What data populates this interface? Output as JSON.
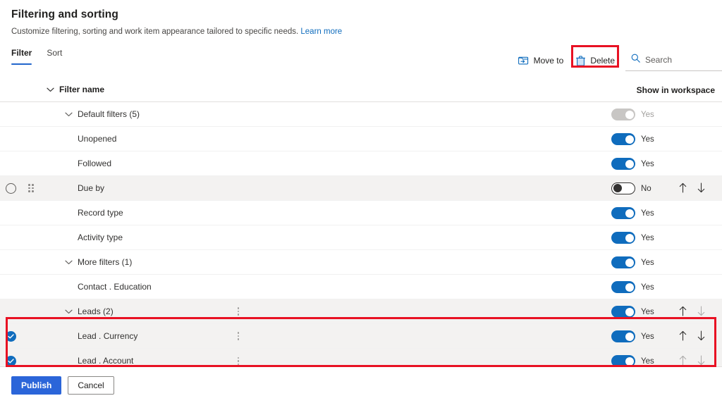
{
  "header": {
    "title": "Filtering and sorting",
    "subtitle": "Customize filtering, sorting and work item appearance tailored to specific needs.",
    "learn_more": "Learn more"
  },
  "tabs": [
    {
      "label": "Filter",
      "active": true
    },
    {
      "label": "Sort",
      "active": false
    }
  ],
  "toolbar": {
    "move_to_label": "Move to",
    "delete_label": "Delete",
    "search_placeholder": "Search",
    "search_value": ""
  },
  "columns": {
    "filter_name": "Filter name",
    "show_in_workspace": "Show in workspace"
  },
  "toggle_labels": {
    "yes": "Yes",
    "no": "No"
  },
  "rows": [
    {
      "name": "Default filters (5)",
      "toggle": "Yes",
      "toggle_state": "disabled"
    },
    {
      "name": "Unopened",
      "toggle": "Yes",
      "toggle_state": "on"
    },
    {
      "name": "Followed",
      "toggle": "Yes",
      "toggle_state": "on"
    },
    {
      "name": "Due by",
      "toggle": "No",
      "toggle_state": "off"
    },
    {
      "name": "Record type",
      "toggle": "Yes",
      "toggle_state": "on"
    },
    {
      "name": "Activity type",
      "toggle": "Yes",
      "toggle_state": "on"
    },
    {
      "name": "More filters (1)",
      "toggle": "Yes",
      "toggle_state": "on"
    },
    {
      "name": "Contact . Education",
      "toggle": "Yes",
      "toggle_state": "on"
    },
    {
      "name": "Leads (2)",
      "toggle": "Yes",
      "toggle_state": "on"
    },
    {
      "name": "Lead . Currency",
      "toggle": "Yes",
      "toggle_state": "on"
    },
    {
      "name": "Lead . Account",
      "toggle": "Yes",
      "toggle_state": "on"
    }
  ],
  "footer": {
    "publish_label": "Publish",
    "cancel_label": "Cancel"
  },
  "colors": {
    "accent": "#0f6cbd",
    "primary_button": "#2b65d9",
    "link": "#0f6cbd",
    "annotation": "#e81123",
    "row_shaded": "#f3f2f1"
  }
}
